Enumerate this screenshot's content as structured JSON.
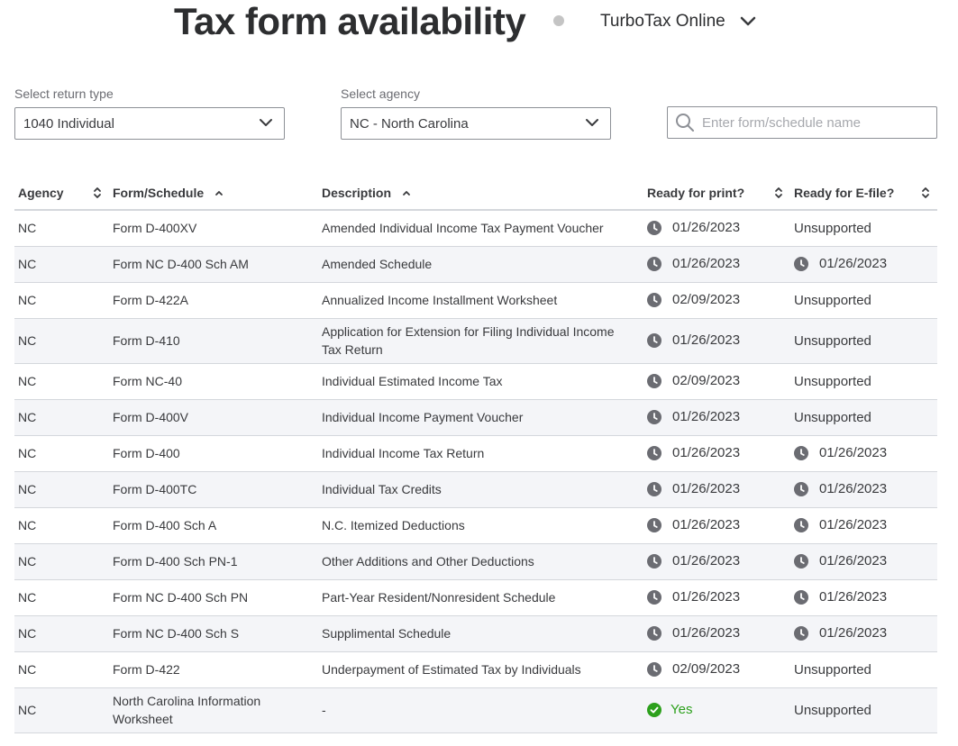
{
  "header": {
    "title": "Tax form availability",
    "product": "TurboTax Online"
  },
  "filters": {
    "return_type_label": "Select return type",
    "return_type_value": "1040 Individual",
    "agency_label": "Select agency",
    "agency_value": "NC - North Carolina",
    "search_placeholder": "Enter form/schedule name"
  },
  "table": {
    "columns": [
      "Agency",
      "Form/Schedule",
      "Description",
      "Ready for print?",
      "Ready for E-file?"
    ],
    "rows": [
      {
        "agency": "NC",
        "form": "Form D-400XV",
        "description": "Amended Individual Income Tax Payment Voucher",
        "print": "01/26/2023",
        "efile": "Unsupported"
      },
      {
        "agency": "NC",
        "form": "Form NC D-400 Sch AM",
        "description": "Amended Schedule",
        "print": "01/26/2023",
        "efile": "01/26/2023"
      },
      {
        "agency": "NC",
        "form": "Form D-422A",
        "description": "Annualized Income Installment Worksheet",
        "print": "02/09/2023",
        "efile": "Unsupported"
      },
      {
        "agency": "NC",
        "form": "Form D-410",
        "description": "Application for Extension for Filing Individual Income Tax Return",
        "print": "01/26/2023",
        "efile": "Unsupported"
      },
      {
        "agency": "NC",
        "form": "Form NC-40",
        "description": "Individual Estimated Income Tax",
        "print": "02/09/2023",
        "efile": "Unsupported"
      },
      {
        "agency": "NC",
        "form": "Form D-400V",
        "description": "Individual Income Payment Voucher",
        "print": "01/26/2023",
        "efile": "Unsupported"
      },
      {
        "agency": "NC",
        "form": "Form D-400",
        "description": "Individual Income Tax Return",
        "print": "01/26/2023",
        "efile": "01/26/2023"
      },
      {
        "agency": "NC",
        "form": "Form D-400TC",
        "description": "Individual Tax Credits",
        "print": "01/26/2023",
        "efile": "01/26/2023"
      },
      {
        "agency": "NC",
        "form": "Form D-400 Sch A",
        "description": "N.C. Itemized Deductions",
        "print": "01/26/2023",
        "efile": "01/26/2023"
      },
      {
        "agency": "NC",
        "form": "Form D-400 Sch PN-1",
        "description": "Other Additions and Other Deductions",
        "print": "01/26/2023",
        "efile": "01/26/2023"
      },
      {
        "agency": "NC",
        "form": "Form NC D-400 Sch PN",
        "description": "Part-Year Resident/Nonresident Schedule",
        "print": "01/26/2023",
        "efile": "01/26/2023"
      },
      {
        "agency": "NC",
        "form": "Form NC D-400 Sch S",
        "description": "Supplimental Schedule",
        "print": "01/26/2023",
        "efile": "01/26/2023"
      },
      {
        "agency": "NC",
        "form": "Form D-422",
        "description": "Underpayment of Estimated Tax by Individuals",
        "print": "02/09/2023",
        "efile": "Unsupported"
      },
      {
        "agency": "NC",
        "form": "North Carolina Information Worksheet",
        "description": "-",
        "print": "Yes",
        "efile": "Unsupported"
      }
    ]
  },
  "icons": {
    "clock": "clock-icon",
    "check": "check-circle-icon",
    "search": "search-icon",
    "chevron": "chevron-down-icon",
    "sort": "sort-icon"
  },
  "colors": {
    "text": "#393a3d",
    "icon_gray": "#6b6c72",
    "yes_green": "#2ca01c",
    "stripe": "#f4f5f8",
    "border": "#d4d7dc"
  }
}
